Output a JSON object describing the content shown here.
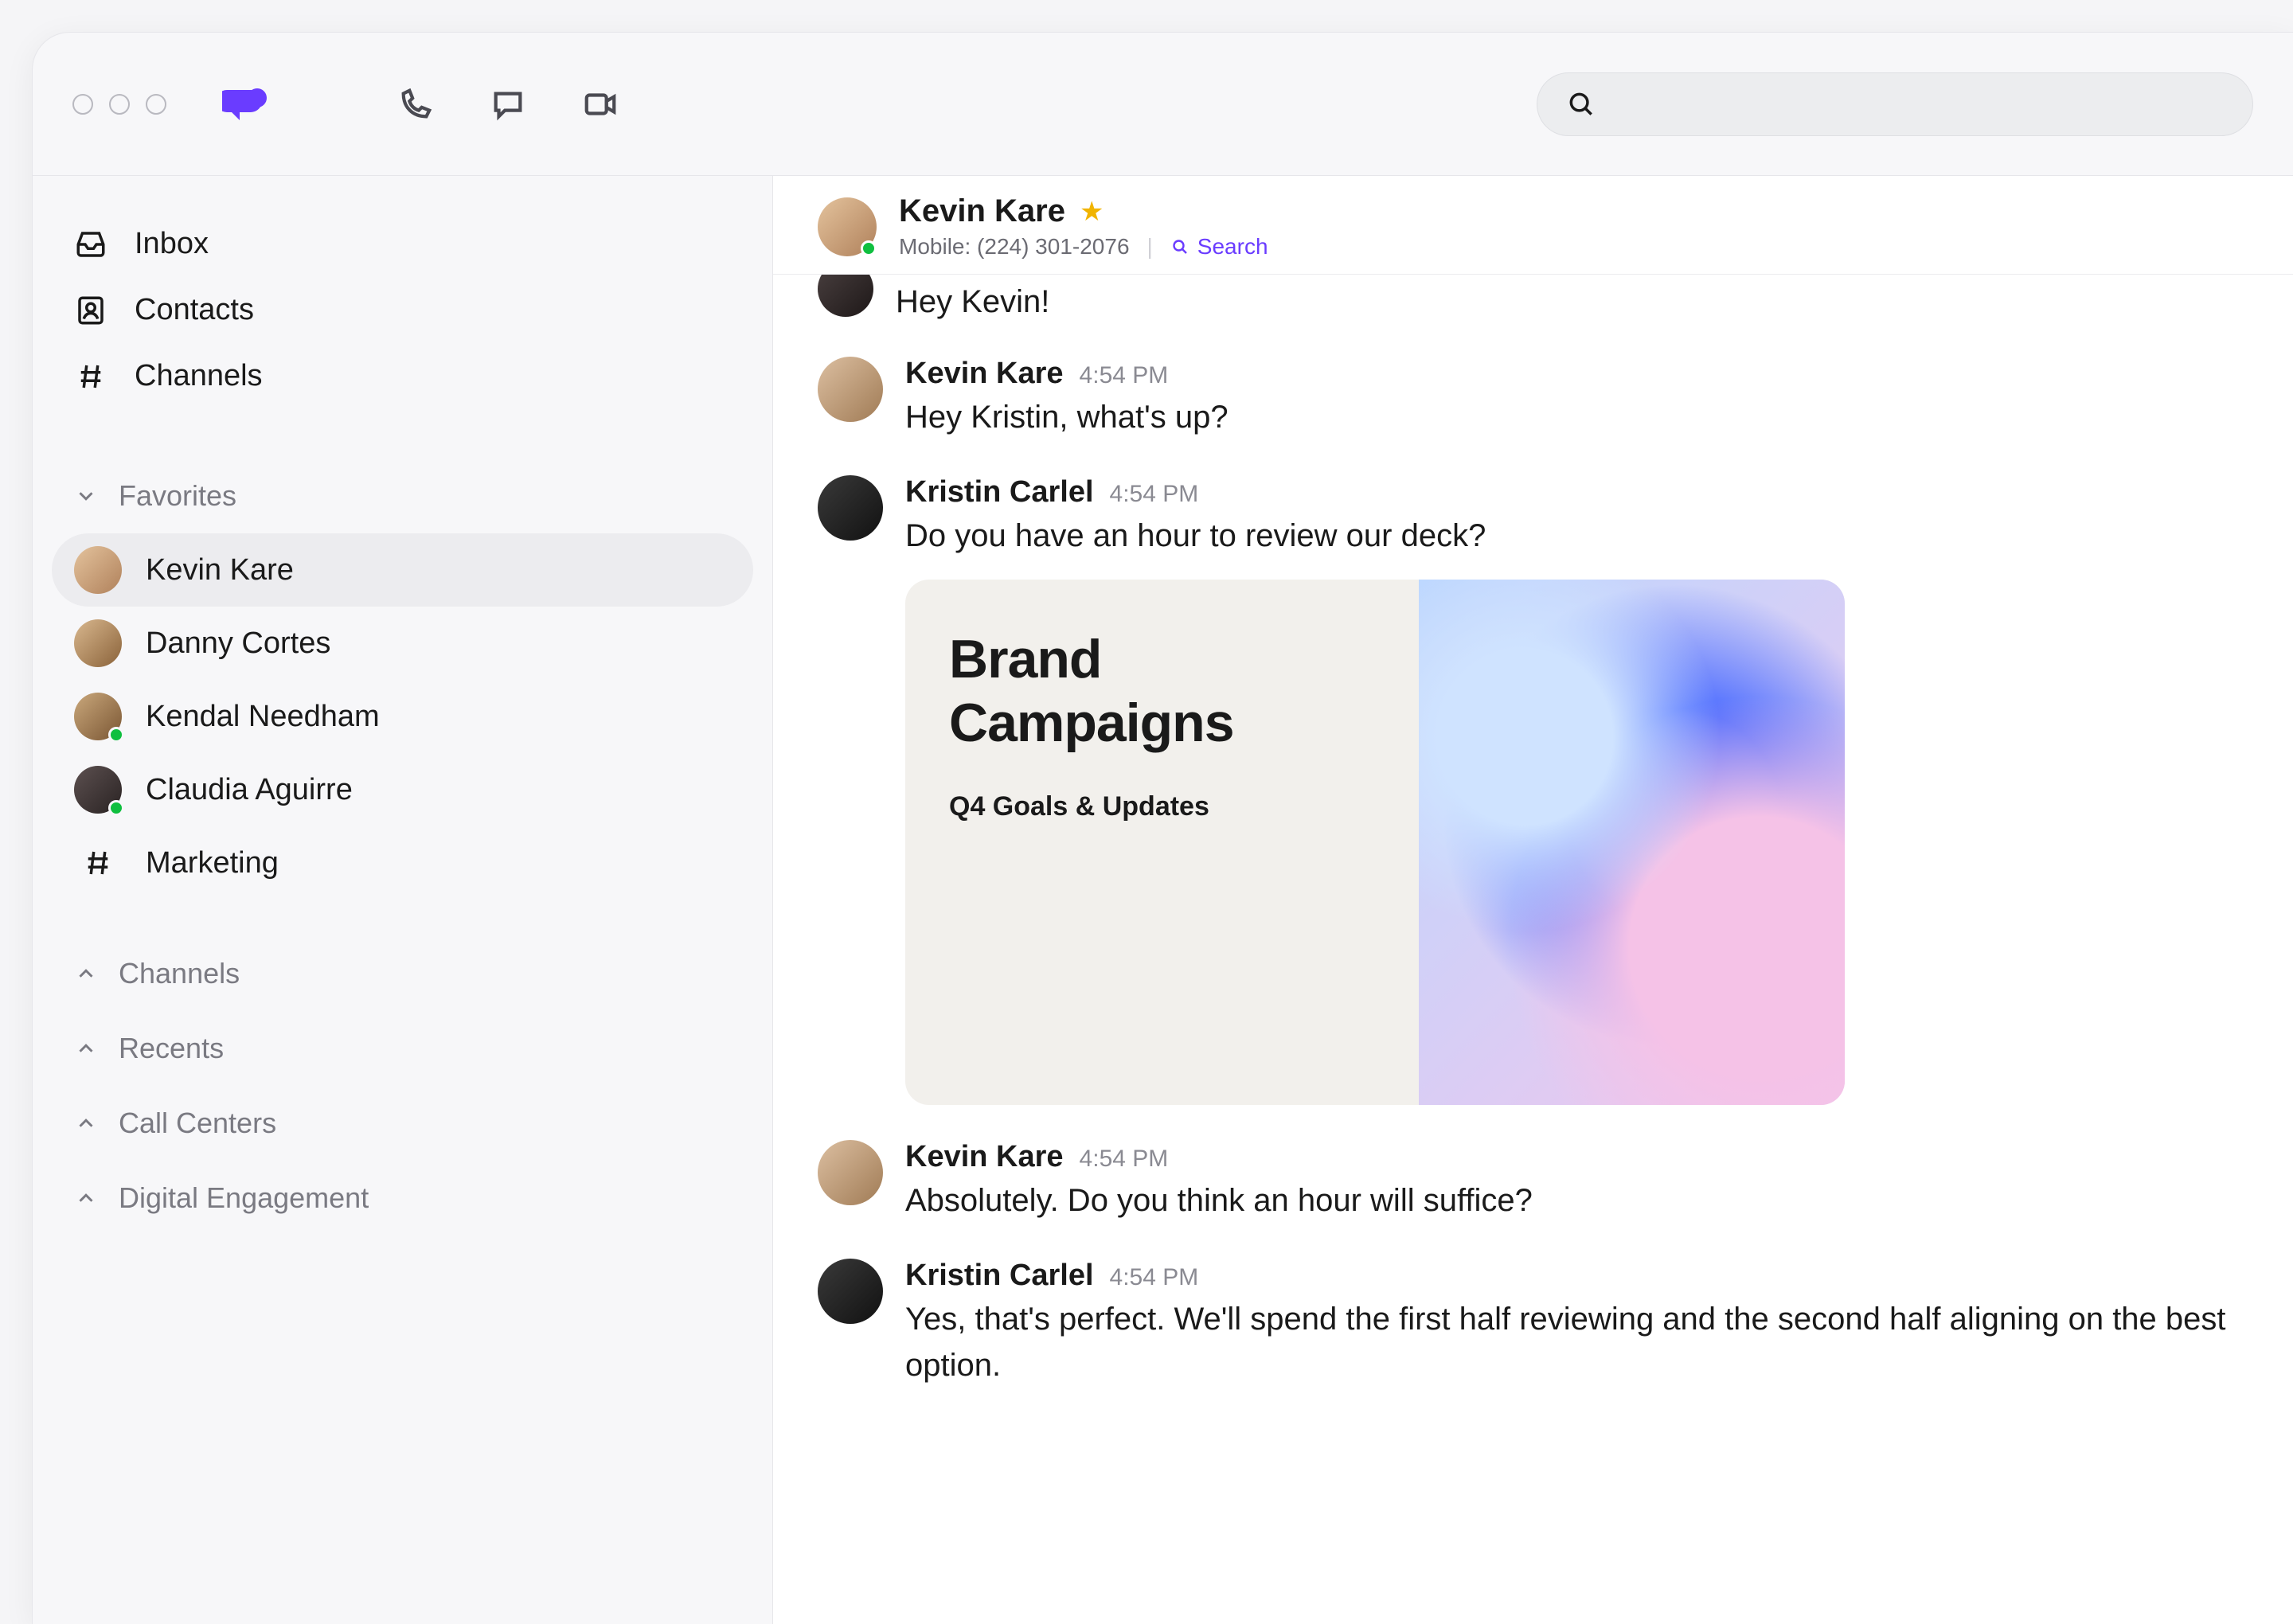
{
  "header": {
    "search_placeholder": ""
  },
  "sidebar": {
    "nav": [
      {
        "label": "Inbox",
        "icon": "inbox"
      },
      {
        "label": "Contacts",
        "icon": "contact"
      },
      {
        "label": "Channels",
        "icon": "hash"
      }
    ],
    "favorites_label": "Favorites",
    "favorites": [
      {
        "label": "Kevin Kare",
        "type": "person",
        "presence": false,
        "active": true
      },
      {
        "label": "Danny Cortes",
        "type": "person",
        "presence": false,
        "active": false
      },
      {
        "label": "Kendal Needham",
        "type": "person",
        "presence": true,
        "active": false
      },
      {
        "label": "Claudia Aguirre",
        "type": "person",
        "presence": true,
        "active": false
      },
      {
        "label": "Marketing",
        "type": "channel",
        "presence": false,
        "active": false
      }
    ],
    "collapsed": [
      "Channels",
      "Recents",
      "Call Centers",
      "Digital Engagement"
    ]
  },
  "conversation": {
    "title": "Kevin Kare",
    "starred": true,
    "phone_label": "Mobile: (224) 301-2076",
    "search_label": "Search"
  },
  "messages": {
    "crumb": "Hey Kevin!",
    "items": [
      {
        "sender": "Kevin Kare",
        "time": "4:54 PM",
        "body": "Hey Kristin, what's up?",
        "avatar": "kevin"
      },
      {
        "sender": "Kristin Carlel",
        "time": "4:54 PM",
        "body": "Do you have an hour to review our deck?",
        "avatar": "kristin",
        "attachment": {
          "title": "Brand Campaigns",
          "subtitle": "Q4 Goals & Updates"
        }
      },
      {
        "sender": "Kevin Kare",
        "time": "4:54 PM",
        "body": "Absolutely. Do you think an hour will suffice?",
        "avatar": "kevin"
      },
      {
        "sender": "Kristin Carlel",
        "time": "4:54 PM",
        "body": "Yes, that's perfect. We'll spend the first half reviewing and the second half aligning on the best option.",
        "avatar": "kristin"
      }
    ]
  }
}
